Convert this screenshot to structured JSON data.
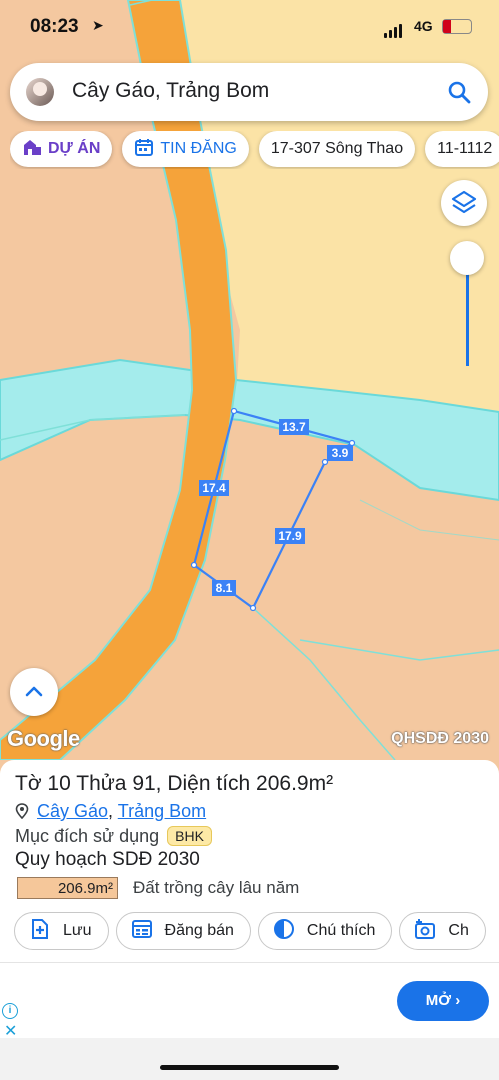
{
  "status_bar": {
    "time": "08:23",
    "network": "4G"
  },
  "search": {
    "query": "Cây Gáo, Trảng Bom"
  },
  "chips": [
    {
      "label": "DỰ ÁN"
    },
    {
      "label": "TIN ĐĂNG"
    },
    {
      "label": "17-307 Sông Thao"
    },
    {
      "label": "11-1112"
    }
  ],
  "map": {
    "edge_labels": [
      "13.7",
      "3.9",
      "17.4",
      "17.9",
      "8.1"
    ],
    "attribution": "Google",
    "layer_name": "QHSDĐ 2030"
  },
  "parcel": {
    "title": "Tờ 10 Thửa 91, Diện tích 206.9m²",
    "commune": "Cây Gáo",
    "separator": ",",
    "district": "Trảng Bom",
    "purpose_label": "Mục đích sử dụng",
    "purpose_code": "BHK",
    "plan_label": "Quy hoạch SDĐ 2030",
    "plan_area": "206.9m²",
    "plan_type": "Đất trồng cây lâu năm"
  },
  "actions": [
    {
      "label": "Lưu"
    },
    {
      "label": "Đăng bán"
    },
    {
      "label": "Chú thích"
    },
    {
      "label": "Ch"
    }
  ],
  "ad": {
    "button_label": "MỞ"
  },
  "colors": {
    "accent": "#1a73e8",
    "land": "#f4c8a0",
    "land_yellow": "#fbe3a6",
    "road": "#f5a33a",
    "river": "#a4ecec"
  }
}
